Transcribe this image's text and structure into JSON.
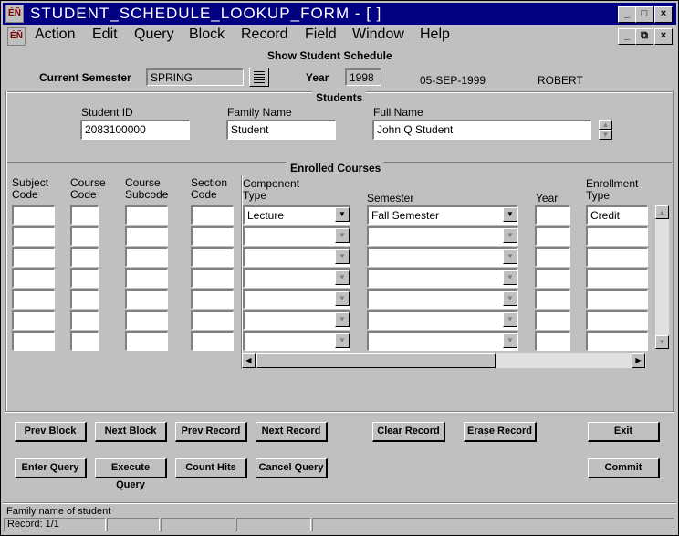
{
  "window": {
    "title": "STUDENT_SCHEDULE_LOOKUP_FORM - [ ]",
    "controls": [
      "_",
      "□",
      "×"
    ],
    "mdi_controls": [
      "_",
      "⧉",
      "×"
    ]
  },
  "menu": [
    "Action",
    "Edit",
    "Query",
    "Block",
    "Record",
    "Field",
    "Window",
    "Help"
  ],
  "header": {
    "form_title": "Show Student Schedule",
    "current_semester_label": "Current Semester",
    "current_semester_value": "SPRING",
    "year_label": "Year",
    "year_value": "1998",
    "date": "05-SEP-1999",
    "user": "ROBERT"
  },
  "students": {
    "section_title": "Students",
    "student_id_label": "Student ID",
    "student_id_value": "2083100000",
    "family_name_label": "Family Name",
    "family_name_value": "Student",
    "full_name_label": "Full Name",
    "full_name_value": "John Q Student"
  },
  "enrolled": {
    "section_title": "Enrolled Courses",
    "columns": {
      "subject_code": [
        "Subject",
        "Code"
      ],
      "course_code": [
        "Course",
        "Code"
      ],
      "course_subcode": [
        "Course",
        "Subcode"
      ],
      "section_code": [
        "Section",
        "Code"
      ],
      "component_type": [
        "Component",
        "Type"
      ],
      "semester": [
        "Semester"
      ],
      "year": [
        "Year"
      ],
      "enrollment_type": [
        "Enrollment",
        "Type"
      ]
    },
    "rows": [
      {
        "component_type": "Lecture",
        "semester": "Fall Semester",
        "enrollment_type": "Credit"
      },
      {
        "component_type": "",
        "semester": "",
        "enrollment_type": ""
      },
      {
        "component_type": "",
        "semester": "",
        "enrollment_type": ""
      },
      {
        "component_type": "",
        "semester": "",
        "enrollment_type": ""
      },
      {
        "component_type": "",
        "semester": "",
        "enrollment_type": ""
      },
      {
        "component_type": "",
        "semester": "",
        "enrollment_type": ""
      },
      {
        "component_type": "",
        "semester": "",
        "enrollment_type": ""
      }
    ]
  },
  "buttons": {
    "prev_block": "Prev Block",
    "next_block": "Next Block",
    "prev_record": "Prev Record",
    "next_record": "Next Record",
    "clear_record": "Clear Record",
    "erase_record": "Erase Record",
    "exit": "Exit",
    "enter_query": "Enter Query",
    "execute_query": "Execute Query",
    "count_hits": "Count Hits",
    "cancel_query": "Cancel Query",
    "commit": "Commit"
  },
  "status": {
    "hint": "Family name of student",
    "record": "Record: 1/1"
  }
}
